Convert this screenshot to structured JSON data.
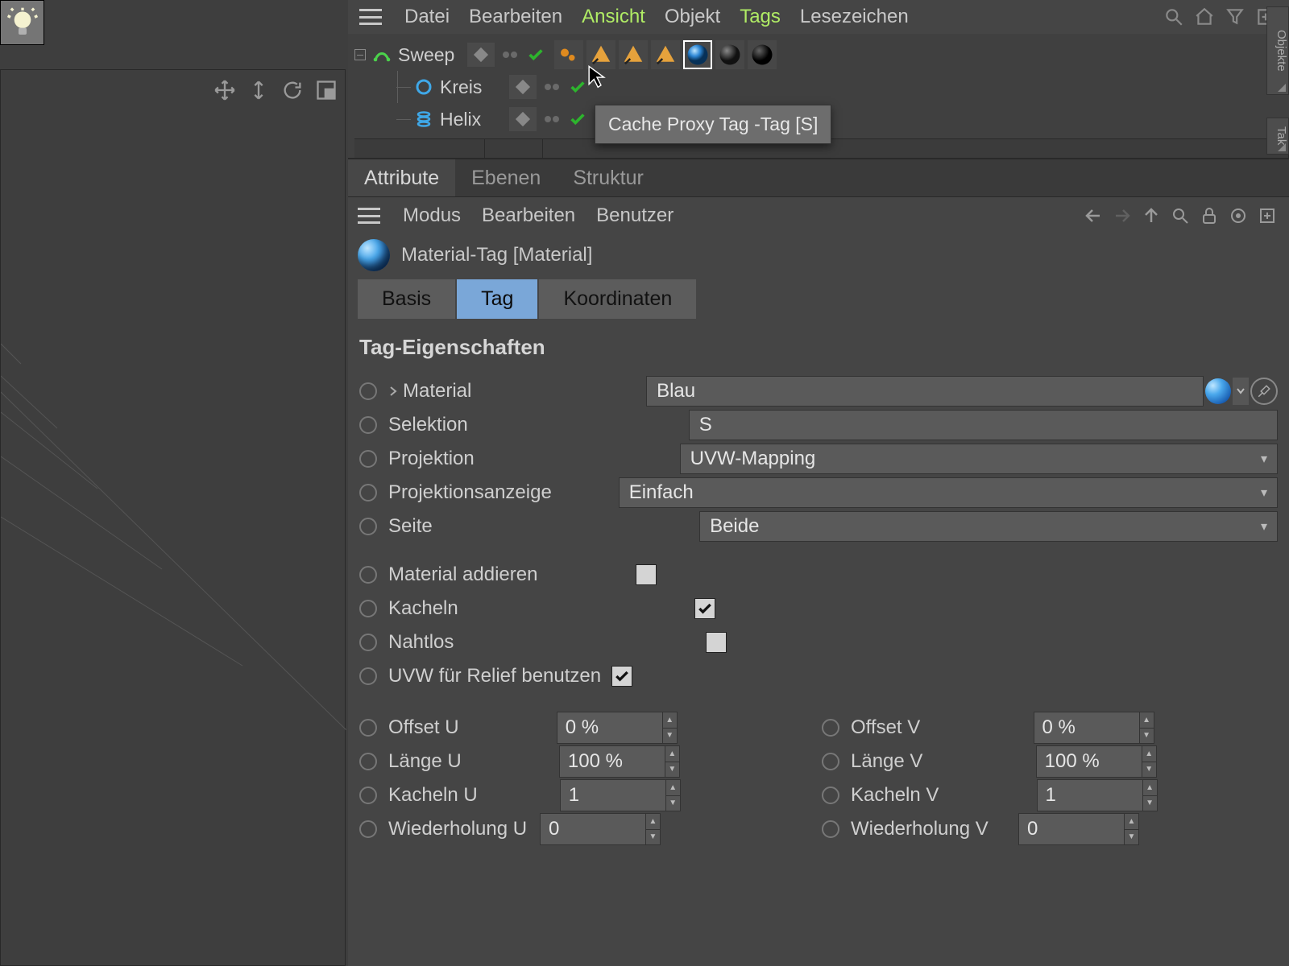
{
  "menubar": {
    "items": [
      "Datei",
      "Bearbeiten",
      "Ansicht",
      "Objekt",
      "Tags",
      "Lesezeichen"
    ],
    "active_index": 2
  },
  "side_tabs": {
    "objects": "Objekte",
    "takes": "Tak"
  },
  "tree": {
    "rows": [
      {
        "name": "Sweep"
      },
      {
        "name": "Kreis"
      },
      {
        "name": "Helix"
      }
    ]
  },
  "tooltip": {
    "text": "Cache Proxy Tag -Tag [S]"
  },
  "panel_tabs": {
    "items": [
      "Attribute",
      "Ebenen",
      "Struktur"
    ],
    "active_index": 0
  },
  "attr_menus": [
    "Modus",
    "Bearbeiten",
    "Benutzer"
  ],
  "material_header": "Material-Tag [Material]",
  "subtabs": {
    "items": [
      "Basis",
      "Tag",
      "Koordinaten"
    ],
    "active_index": 1
  },
  "section_title": "Tag-Eigenschaften",
  "props": {
    "material": {
      "label": "Material",
      "value": "Blau"
    },
    "selektion": {
      "label": "Selektion",
      "value": "S"
    },
    "projektion": {
      "label": "Projektion",
      "value": "UVW-Mapping"
    },
    "projanzeige": {
      "label": "Projektionsanzeige",
      "value": "Einfach"
    },
    "seite": {
      "label": "Seite",
      "value": "Beide"
    },
    "material_add": {
      "label": "Material addieren",
      "checked": false
    },
    "kacheln": {
      "label": "Kacheln",
      "checked": true
    },
    "nahtlos": {
      "label": "Nahtlos",
      "checked": false
    },
    "uvw_relief": {
      "label": "UVW für Relief benutzen",
      "checked": true
    },
    "offset_u": {
      "label": "Offset U",
      "value": "0 %"
    },
    "offset_v": {
      "label": "Offset V",
      "value": "0 %"
    },
    "laenge_u": {
      "label": "Länge U",
      "value": "100 %"
    },
    "laenge_v": {
      "label": "Länge V",
      "value": "100 %"
    },
    "kacheln_u": {
      "label": "Kacheln U",
      "value": "1"
    },
    "kacheln_v": {
      "label": "Kacheln V",
      "value": "1"
    },
    "wieder_u": {
      "label": "Wiederholung U",
      "value": "0"
    },
    "wieder_v": {
      "label": "Wiederholung V",
      "value": "0"
    }
  }
}
